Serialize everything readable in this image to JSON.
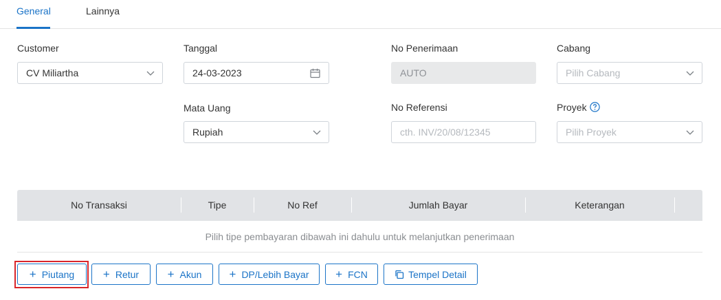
{
  "tabs": {
    "general": "General",
    "lainnya": "Lainnya"
  },
  "form": {
    "customer": {
      "label": "Customer",
      "value": "CV Miliartha"
    },
    "tanggal": {
      "label": "Tanggal",
      "value": "24-03-2023"
    },
    "no_penerimaan": {
      "label": "No Penerimaan",
      "value": "AUTO"
    },
    "cabang": {
      "label": "Cabang",
      "placeholder": "Pilih Cabang"
    },
    "mata_uang": {
      "label": "Mata Uang",
      "value": "Rupiah"
    },
    "no_referensi": {
      "label": "No Referensi",
      "placeholder": "cth. INV/20/08/12345"
    },
    "proyek": {
      "label": "Proyek",
      "placeholder": "Pilih Proyek"
    }
  },
  "table": {
    "columns": [
      "No Transaksi",
      "Tipe",
      "No Ref",
      "Jumlah Bayar",
      "Keterangan"
    ],
    "empty_message": "Pilih tipe pembayaran dibawah ini dahulu untuk melanjutkan penerimaan"
  },
  "buttons": {
    "piutang": "Piutang",
    "retur": "Retur",
    "akun": "Akun",
    "dp": "DP/Lebih Bayar",
    "fcn": "FCN",
    "tempel": "Tempel Detail"
  },
  "colors": {
    "accent": "#1a73c7",
    "highlight": "#d9252a",
    "header_bg": "#e1e3e6"
  }
}
